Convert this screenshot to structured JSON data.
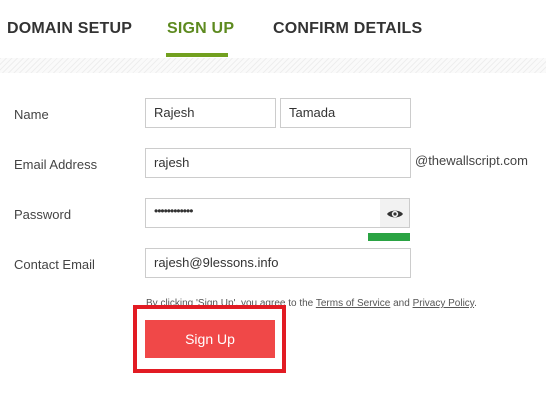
{
  "tabs": [
    {
      "label": "DOMAIN SETUP"
    },
    {
      "label": "SIGN UP"
    },
    {
      "label": "CONFIRM DETAILS"
    }
  ],
  "active_tab": "SIGN UP",
  "form": {
    "name_label": "Name",
    "first_name_value": "Rajesh",
    "last_name_value": "Tamada",
    "email_label": "Email Address",
    "email_value": "rajesh",
    "email_suffix": "@thewallscript.com",
    "password_label": "Password",
    "password_value": "••••••••••••",
    "password_strength": 1.0,
    "contact_email_label": "Contact Email",
    "contact_email_value": "rajesh@9lessons.info"
  },
  "terms": {
    "prefix": "By clicking 'Sign Up', you agree to the ",
    "terms_link": "Terms of Service",
    "and": " and ",
    "privacy_link": "Privacy Policy",
    "suffix": "."
  },
  "signup_button": {
    "label": "Sign Up"
  },
  "colors": {
    "active_tab": "#5d8a1f",
    "tab_underline": "#72a01f",
    "strength": "#2aa343",
    "button": "#f04848",
    "highlight": "#e21b23"
  },
  "icons": {
    "password_toggle": "eye-icon"
  }
}
